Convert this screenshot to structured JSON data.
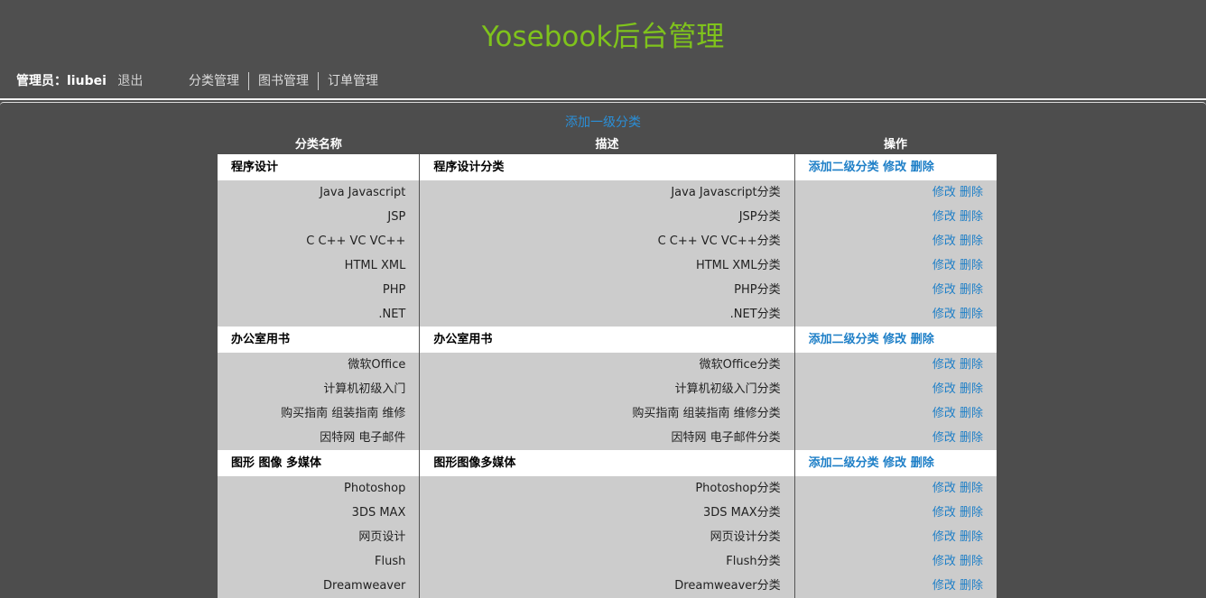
{
  "header": {
    "title": "Yosebook后台管理",
    "admin_label": "管理员：",
    "admin_name": "liubei",
    "logout": "退出",
    "nav": [
      "分类管理",
      "图书管理",
      "订单管理"
    ]
  },
  "main": {
    "add_top_label": "添加一级分类",
    "columns": [
      "分类名称",
      "描述",
      "操作"
    ]
  },
  "ops": {
    "add_sub": "添加二级分类",
    "edit": "修改",
    "delete": "删除"
  },
  "categories": [
    {
      "name": "程序设计",
      "desc": "程序设计分类",
      "children": [
        {
          "name": "Java Javascript",
          "desc": "Java Javascript分类"
        },
        {
          "name": "JSP",
          "desc": "JSP分类"
        },
        {
          "name": "C C++ VC VC++",
          "desc": "C C++ VC VC++分类"
        },
        {
          "name": "HTML XML",
          "desc": "HTML XML分类"
        },
        {
          "name": "PHP",
          "desc": "PHP分类"
        },
        {
          "name": ".NET",
          "desc": ".NET分类"
        }
      ]
    },
    {
      "name": "办公室用书",
      "desc": "办公室用书",
      "children": [
        {
          "name": "微软Office",
          "desc": "微软Office分类"
        },
        {
          "name": "计算机初级入门",
          "desc": "计算机初级入门分类"
        },
        {
          "name": "购买指南 组装指南 维修",
          "desc": "购买指南 组装指南 维修分类"
        },
        {
          "name": "因特网 电子邮件",
          "desc": "因特网 电子邮件分类"
        }
      ]
    },
    {
      "name": "图形 图像 多媒体",
      "desc": "图形图像多媒体",
      "children": [
        {
          "name": "Photoshop",
          "desc": "Photoshop分类"
        },
        {
          "name": "3DS MAX",
          "desc": "3DS MAX分类"
        },
        {
          "name": "网页设计",
          "desc": "网页设计分类"
        },
        {
          "name": "Flush",
          "desc": "Flush分类"
        },
        {
          "name": "Dreamweaver",
          "desc": "Dreamweaver分类"
        }
      ]
    }
  ],
  "colors": {
    "title": "#7fc31c",
    "link": "#1e7fc7",
    "background": "#4d4d4d",
    "sub_row": "#cccccc"
  }
}
